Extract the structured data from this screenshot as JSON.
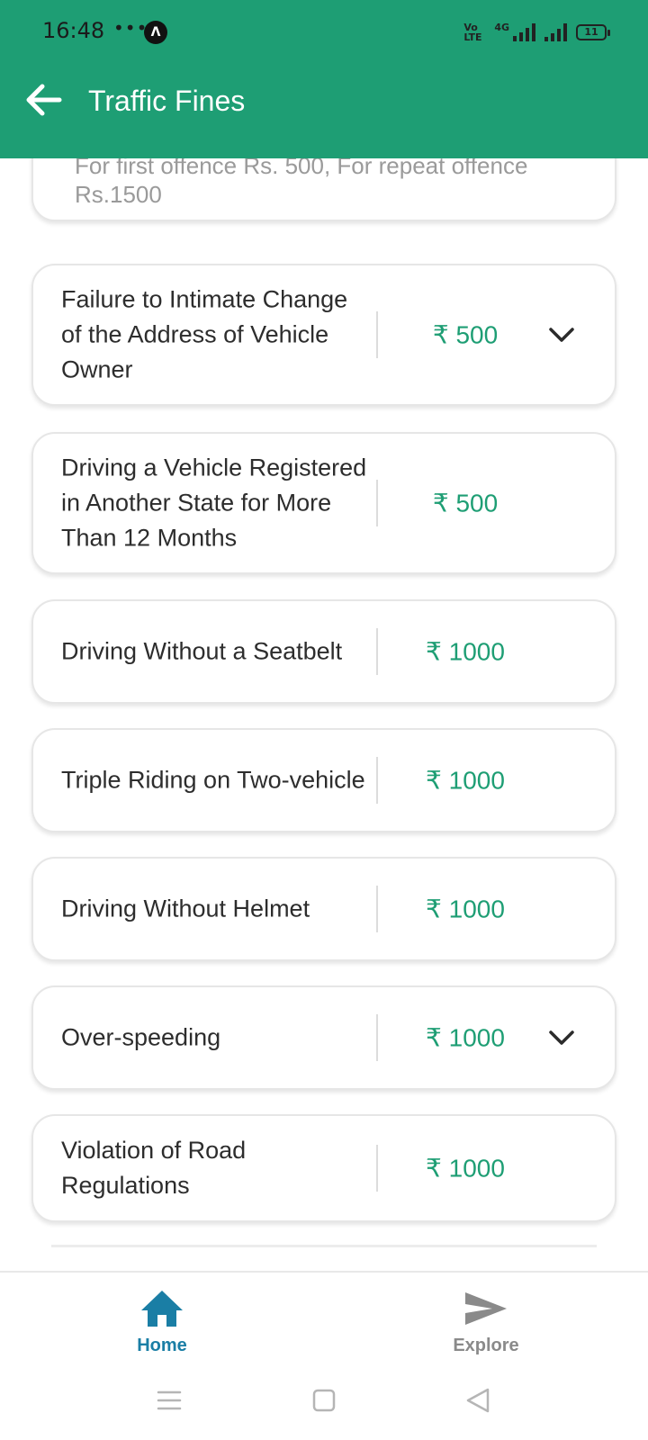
{
  "status_bar": {
    "time": "16:48",
    "dots": "•••",
    "nav_badge": "Λ",
    "volte": "Vo LTE",
    "network": "4G",
    "battery": "11"
  },
  "header": {
    "title": "Traffic Fines",
    "background_color": "#1e9e74"
  },
  "partial_card": {
    "note": "For first offence Rs. 500, For repeat offence Rs.1500"
  },
  "fines": [
    {
      "name": "Failure to Intimate Change of the Address of Vehicle Owner",
      "amount": "₹ 500",
      "expandable": true
    },
    {
      "name": "Driving a Vehicle Registered in Another State for More Than 12 Months",
      "amount": "₹ 500",
      "expandable": false
    },
    {
      "name": "Driving Without a Seatbelt",
      "amount": "₹ 1000",
      "expandable": false
    },
    {
      "name": "Triple Riding on Two-vehicle",
      "amount": "₹ 1000",
      "expandable": false
    },
    {
      "name": "Driving Without Helmet",
      "amount": "₹ 1000",
      "expandable": false
    },
    {
      "name": "Over-speeding",
      "amount": "₹ 1000",
      "expandable": true
    },
    {
      "name": "Violation of Road Regulations",
      "amount": "₹ 1000",
      "expandable": false
    }
  ],
  "bottom_nav": {
    "home_label": "Home",
    "explore_label": "Explore",
    "active_color": "#1a7ea5",
    "inactive_color": "#8a8a8a"
  },
  "icons": {
    "back": "back-arrow-icon",
    "expand": "chevron-down-icon",
    "home": "home-icon",
    "explore": "send-icon",
    "menu": "menu-icon",
    "recents": "square-icon",
    "system_back": "triangle-back-icon"
  },
  "accent_color": "#1e9e74"
}
